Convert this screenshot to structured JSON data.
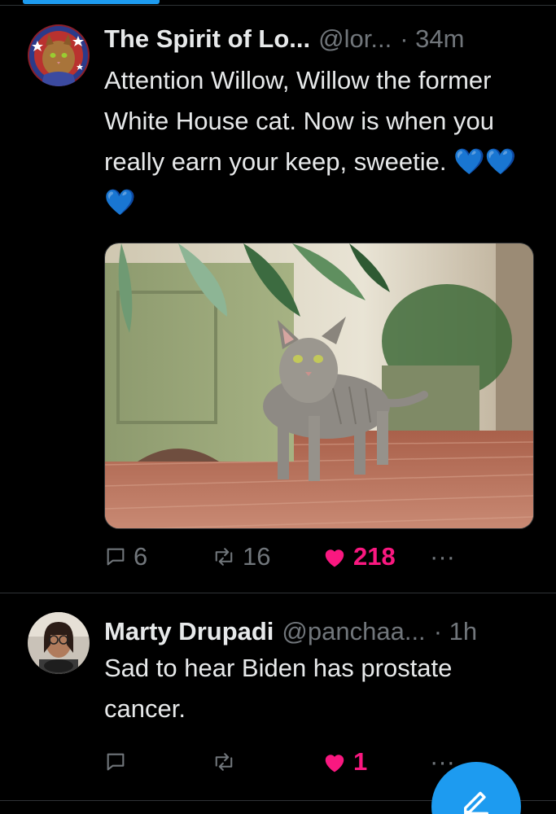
{
  "tweets": [
    {
      "display_name": "The Spirit of Lo...",
      "handle": "@lor...",
      "time": "· 34m",
      "text": "Attention Willow, Willow the former White House cat. Now is when you really earn your keep, sweetie. 💙💙💙",
      "has_media": true,
      "media_description_icon": "photo-of-gray-tabby-cat",
      "reply_count": "6",
      "retweet_count": "16",
      "like_count": "218",
      "liked": true
    },
    {
      "display_name": "Marty Drupadi",
      "handle": "@panchaa...",
      "time": "· 1h",
      "text": "Sad to hear Biden has prostate cancer.",
      "has_media": false,
      "reply_count": "",
      "retweet_count": "",
      "like_count": "1",
      "liked": true
    }
  ],
  "more_label": "···",
  "colors": {
    "background": "#000000",
    "text": "#e7e9ea",
    "secondary": "#71767b",
    "accent": "#1d9bf0",
    "like": "#f91880",
    "heart_emoji": "#1d8cf8"
  },
  "fab_icon": "compose-icon"
}
